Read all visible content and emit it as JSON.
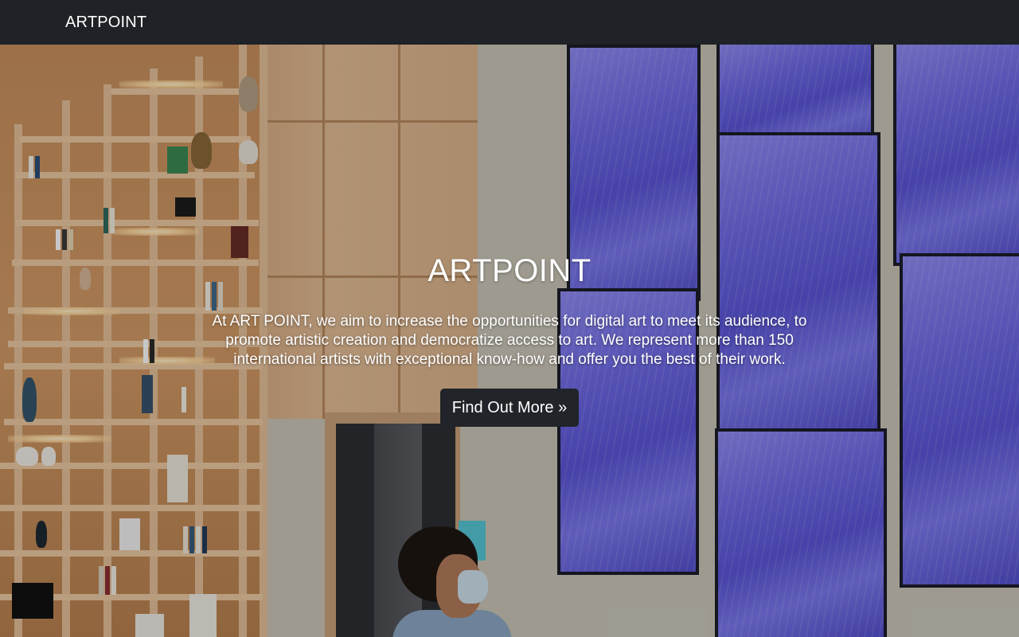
{
  "navbar": {
    "brand": "ARTPOINT"
  },
  "hero": {
    "title": "ARTPOINT",
    "text": "At ART POINT, we aim to increase the opportunities for digital art to meet its audience, to promote artistic creation and democratize access to art. We represent more than 150 international artists with exceptional know-how and offer you the best of their work.",
    "cta_label": "Find Out More »"
  },
  "colors": {
    "navbar_bg": "#1f2226",
    "button_bg": "#212428",
    "text": "#ffffff"
  }
}
